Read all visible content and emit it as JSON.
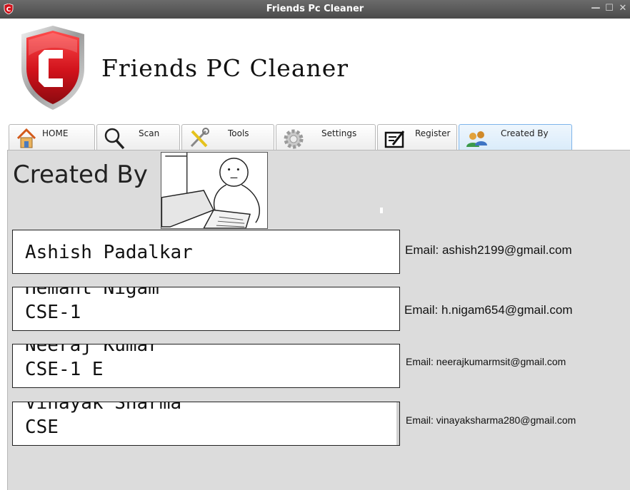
{
  "window": {
    "title": "Friends Pc Cleaner",
    "minimize_glyph": "—",
    "maximize_glyph": "☐",
    "close_glyph": "✕"
  },
  "header": {
    "app_name": "Friends PC Cleaner",
    "logo_icon": "red-shield-c-logo"
  },
  "tabs": [
    {
      "label": "HOME",
      "icon": "house-icon"
    },
    {
      "label": "Scan",
      "icon": "magnifier-icon"
    },
    {
      "label": "Tools",
      "icon": "tools-icon"
    },
    {
      "label": "Settings",
      "icon": "gear-icon"
    },
    {
      "label": "Register",
      "icon": "register-icon"
    },
    {
      "label": "Created By",
      "icon": "users-icon",
      "active": true
    }
  ],
  "content": {
    "title": "Created By",
    "members": [
      {
        "name": "Ashish Padalkar",
        "dept": "",
        "email": "Email: ashish2199@gmail.com"
      },
      {
        "name": "Hemant Nigam",
        "dept": "CSE-1",
        "email": "Email: h.nigam654@gmail.com"
      },
      {
        "name": "Neeraj Kumar",
        "dept": "CSE-1 E",
        "email": "Email: neerajkumarmsit@gmail.com"
      },
      {
        "name": "Vinayak Sharma",
        "dept": "CSE",
        "email": "Email: vinayaksharma280@gmail.com"
      }
    ]
  },
  "colors": {
    "titlebar": "#555555",
    "logo_red": "#d0121b",
    "active_tab": "#d9ebfa",
    "panel": "#dcdcdc"
  }
}
